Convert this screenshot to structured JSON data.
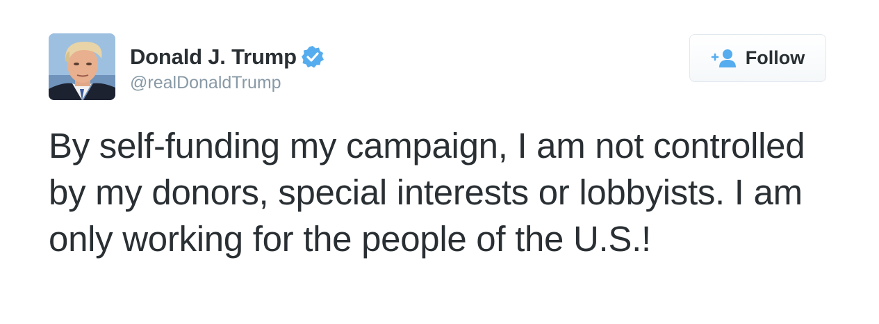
{
  "author": {
    "display_name": "Donald J. Trump",
    "handle": "@realDonaldTrump",
    "verified": true,
    "avatar_icon": "profile-photo"
  },
  "actions": {
    "follow_label": "Follow",
    "follow_icon": "add-user-icon"
  },
  "tweet": {
    "text": "By self-funding my campaign, I am not controlled by my donors, special interests or lobbyists. I am only working for the people of the U.S.!"
  },
  "colors": {
    "text": "#292f33",
    "secondary_text": "#8899a6",
    "verified_blue": "#55acee",
    "border": "#e1e8ed"
  }
}
